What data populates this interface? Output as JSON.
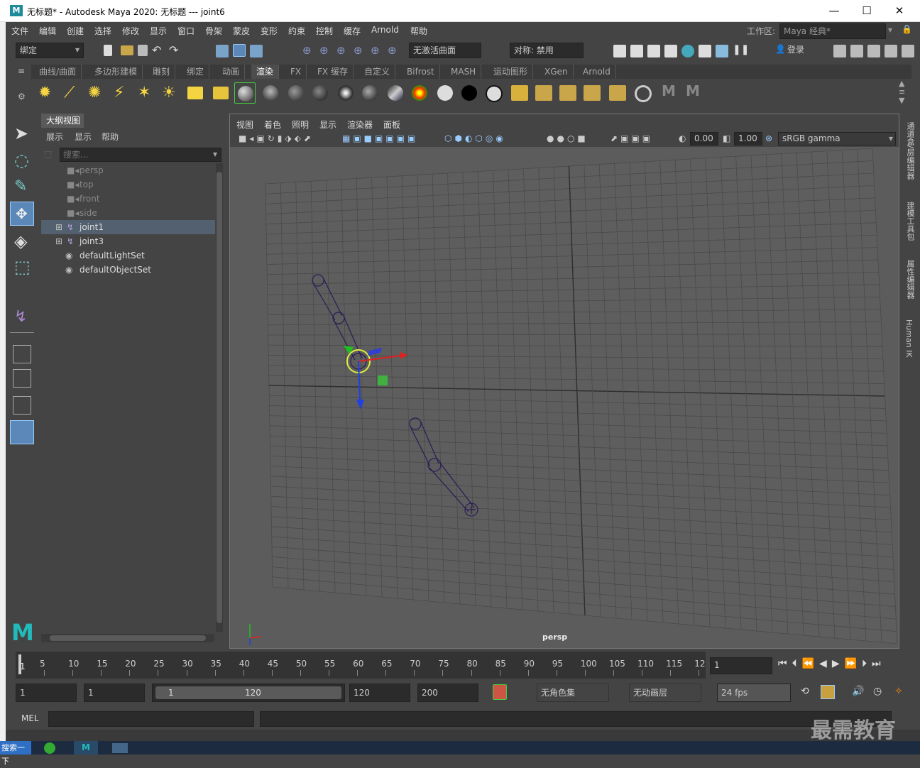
{
  "window": {
    "title": "无标题* - Autodesk Maya 2020: 无标题   ---   joint6",
    "logo": "M",
    "controls": [
      "—",
      "☐",
      "✕"
    ]
  },
  "menubar": {
    "items": [
      "文件",
      "编辑",
      "创建",
      "选择",
      "修改",
      "显示",
      "窗口",
      "骨架",
      "蒙皮",
      "变形",
      "约束",
      "控制",
      "缓存",
      "Arnold",
      "帮助"
    ],
    "workspace_label": "工作区:",
    "workspace_value": "Maya 经典*"
  },
  "statusline": {
    "menuset": "绑定",
    "live_surface": "无激活曲面",
    "symmetry": "对称: 禁用",
    "login": "登录"
  },
  "shelf": {
    "tabs": [
      "曲线/曲面",
      "多边形建模",
      "雕刻",
      "绑定",
      "动画",
      "渲染",
      "FX",
      "FX 缓存",
      "自定义",
      "Bifrost",
      "MASH",
      "运动图形",
      "XGen",
      "Arnold"
    ],
    "active_tab": "渲染"
  },
  "outliner": {
    "title": "大纲视图",
    "menu": [
      "展示",
      "显示",
      "帮助"
    ],
    "search_placeholder": "搜索...",
    "items": [
      {
        "label": "persp",
        "type": "camera",
        "dim": true
      },
      {
        "label": "top",
        "type": "camera",
        "dim": true
      },
      {
        "label": "front",
        "type": "camera",
        "dim": true
      },
      {
        "label": "side",
        "type": "camera",
        "dim": true
      },
      {
        "label": "joint1",
        "type": "joint",
        "selected": true
      },
      {
        "label": "joint3",
        "type": "joint"
      },
      {
        "label": "defaultLightSet",
        "type": "set"
      },
      {
        "label": "defaultObjectSet",
        "type": "set"
      }
    ]
  },
  "viewport": {
    "menu": [
      "视图",
      "着色",
      "照明",
      "显示",
      "渲染器",
      "面板"
    ],
    "exposure": "0.00",
    "gamma": "1.00",
    "color_space": "sRGB gamma",
    "camera_label": "persp"
  },
  "right_tabs": [
    "通道盒/层编辑器",
    "建模工具包",
    "属性编辑器",
    "Human IK"
  ],
  "timeline": {
    "ticks": [
      "5",
      "10",
      "15",
      "20",
      "25",
      "30",
      "35",
      "40",
      "45",
      "50",
      "55",
      "60",
      "65",
      "70",
      "75",
      "80",
      "85",
      "90",
      "95",
      "100",
      "105",
      "110",
      "115",
      "12"
    ],
    "start_marker": "1",
    "current_frame": "1"
  },
  "range": {
    "start": "1",
    "playback_start": "1",
    "slider_start": "1",
    "slider_end": "120",
    "playback_end": "120",
    "end": "200",
    "character_set": "无角色集",
    "anim_layer": "无动画层",
    "fps": "24 fps"
  },
  "command": {
    "label": "MEL"
  },
  "taskbar": {
    "search": "搜索一下"
  },
  "watermark": "最需教育"
}
